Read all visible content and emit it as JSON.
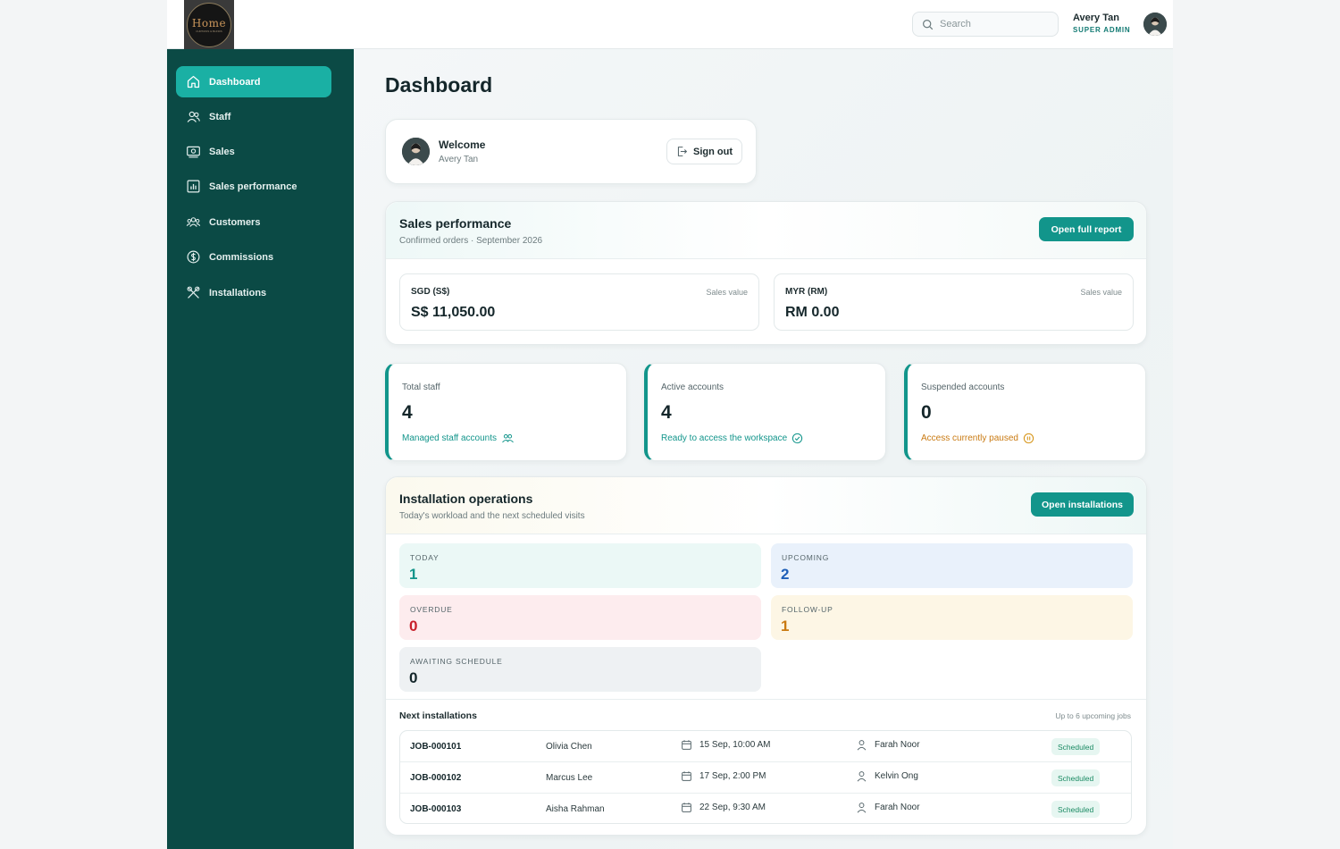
{
  "brand": {
    "logo_text": "Home",
    "logo_subtext": "CURTAINS & BLINDS"
  },
  "header": {
    "search_placeholder": "Search",
    "user_name": "Avery Tan",
    "user_role": "SUPER ADMIN"
  },
  "sidebar": {
    "items": [
      {
        "label": "Dashboard",
        "icon": "home-icon",
        "active": true
      },
      {
        "label": "Staff",
        "icon": "users-icon"
      },
      {
        "label": "Sales",
        "icon": "cash-icon"
      },
      {
        "label": "Sales performance",
        "icon": "bar-chart-icon"
      },
      {
        "label": "Customers",
        "icon": "customers-icon"
      },
      {
        "label": "Commissions",
        "icon": "dollar-circle-icon"
      },
      {
        "label": "Installations",
        "icon": "tools-icon"
      }
    ]
  },
  "page": {
    "title": "Dashboard"
  },
  "welcome": {
    "title": "Welcome",
    "name": "Avery Tan",
    "signout_label": "Sign out"
  },
  "sales": {
    "title": "Sales performance",
    "subtitle": "Confirmed orders · September 2026",
    "button": "Open full report",
    "currencies": [
      {
        "code": "SGD (S$)",
        "label": "Sales value",
        "value": "S$ 11,050.00"
      },
      {
        "code": "MYR (RM)",
        "label": "Sales value",
        "value": "RM 0.00"
      }
    ]
  },
  "stats": [
    {
      "label": "Total staff",
      "value": "4",
      "note": "Managed staff accounts",
      "color": "#12958b"
    },
    {
      "label": "Active accounts",
      "value": "4",
      "note": "Ready to access the workspace",
      "color": "#12958b"
    },
    {
      "label": "Suspended accounts",
      "value": "0",
      "note": "Access currently paused",
      "color": "#c97a12"
    }
  ],
  "installations": {
    "title": "Installation operations",
    "subtitle": "Today's workload and the next scheduled visits",
    "button": "Open installations",
    "tiles": [
      {
        "label": "TODAY",
        "value": "1",
        "bg": "#ebf8f6",
        "color": "#12958b"
      },
      {
        "label": "UPCOMING",
        "value": "2",
        "bg": "#e9f1fb",
        "color": "#1f5fb8"
      },
      {
        "label": "OVERDUE",
        "value": "0",
        "bg": "#fdecee",
        "color": "#c8202b"
      },
      {
        "label": "FOLLOW-UP",
        "value": "1",
        "bg": "#fdf6e5",
        "color": "#c97a12"
      },
      {
        "label": "AWAITING SCHEDULE",
        "value": "0",
        "bg": "#eef1f3",
        "color": "#14262a"
      }
    ],
    "next_title": "Next installations",
    "next_note": "Up to 6 upcoming jobs",
    "jobs": [
      {
        "id": "JOB-000101",
        "customer": "Olivia Chen",
        "date": "15 Sep, 10:00 AM",
        "tech": "Farah Noor",
        "status": "Scheduled"
      },
      {
        "id": "JOB-000102",
        "customer": "Marcus Lee",
        "date": "17 Sep, 2:00 PM",
        "tech": "Kelvin Ong",
        "status": "Scheduled"
      },
      {
        "id": "JOB-000103",
        "customer": "Aisha Rahman",
        "date": "22 Sep, 9:30 AM",
        "tech": "Farah Noor",
        "status": "Scheduled"
      }
    ]
  }
}
